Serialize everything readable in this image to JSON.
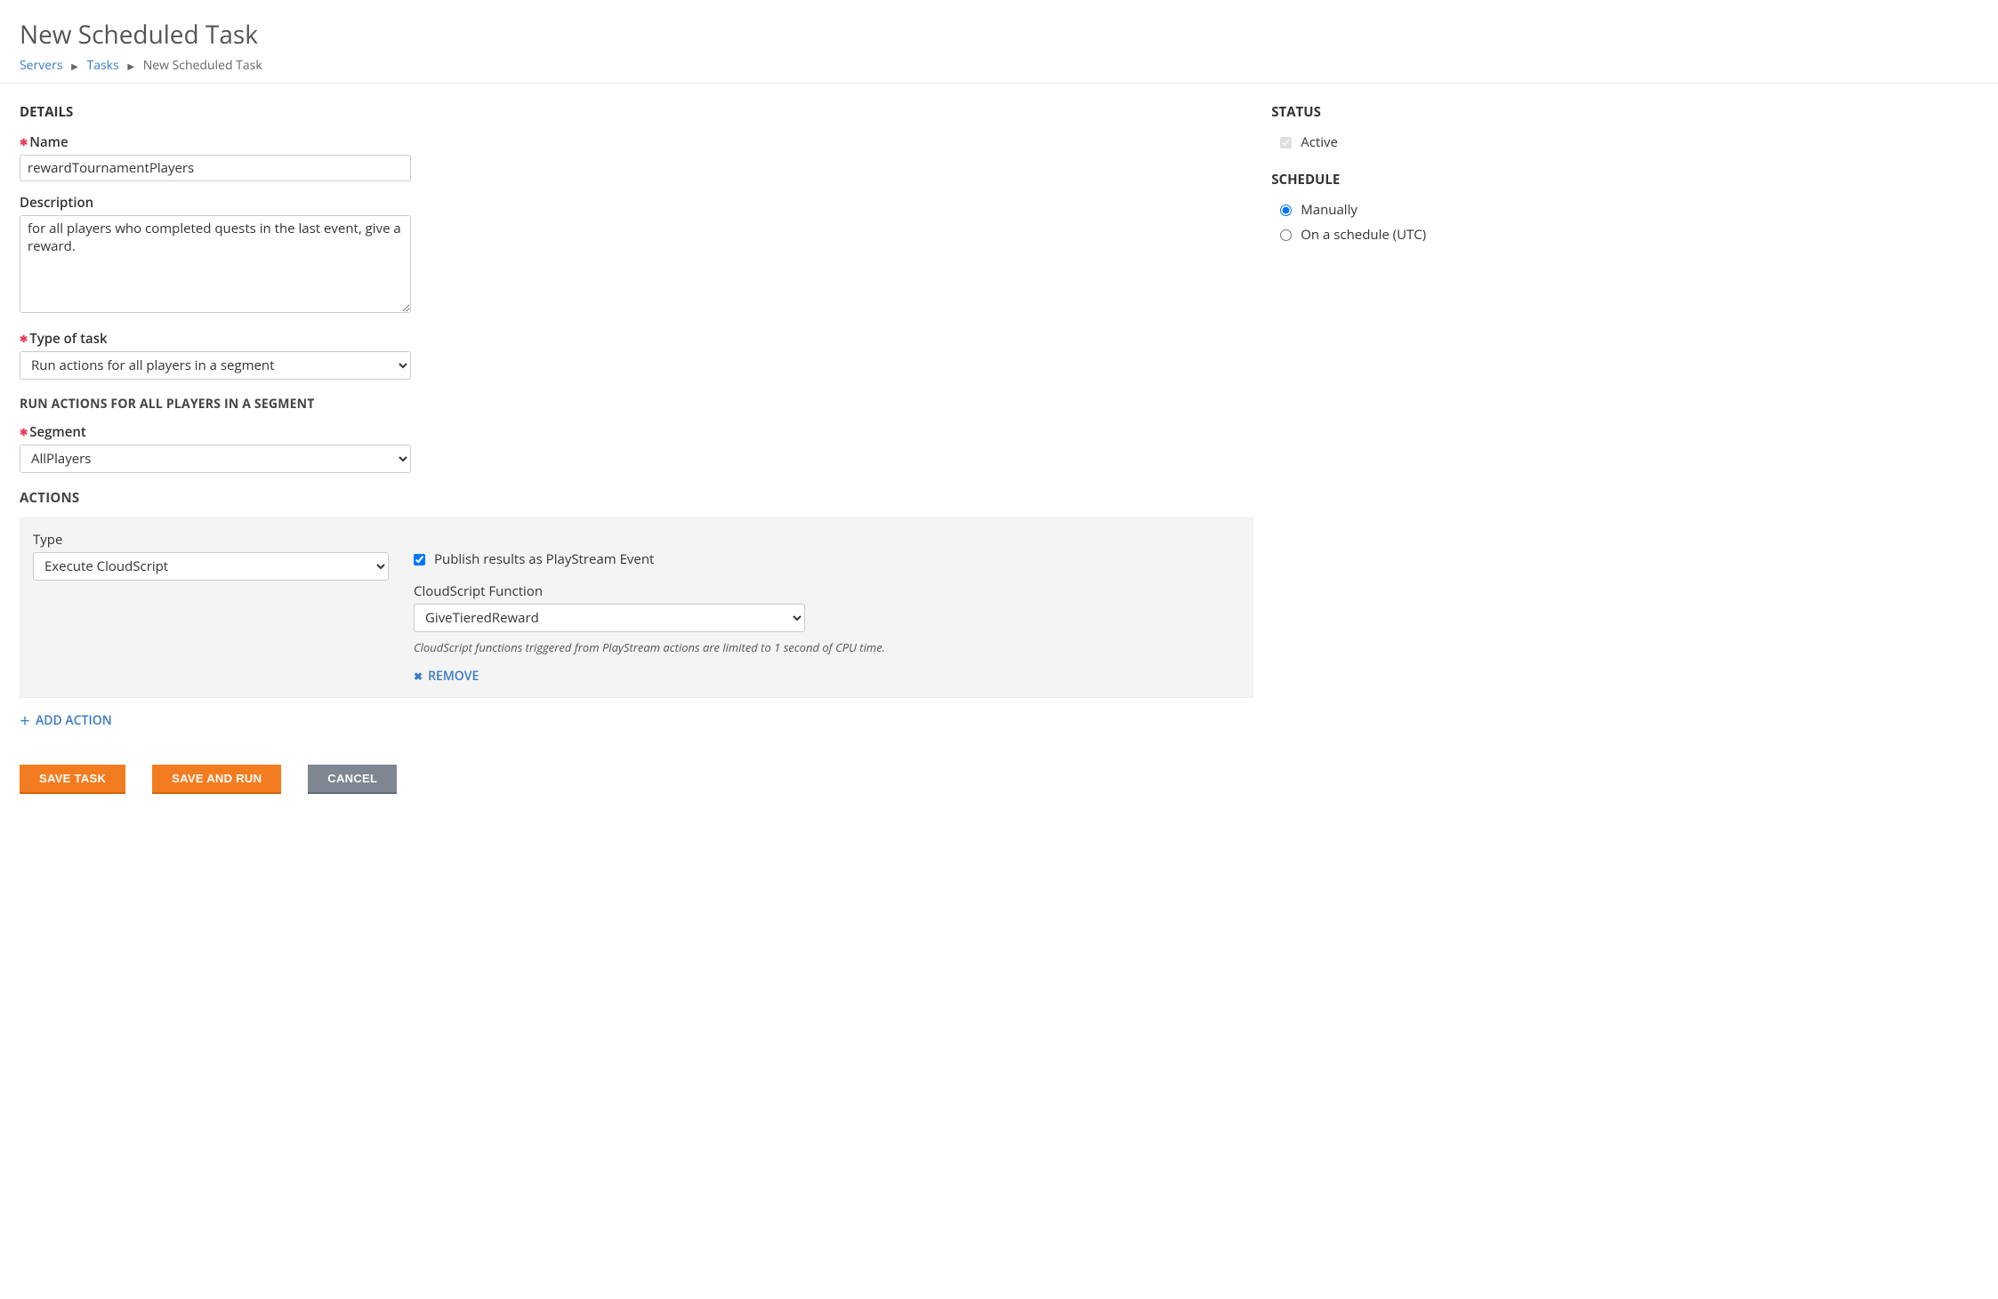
{
  "header": {
    "title": "New Scheduled Task",
    "breadcrumb": {
      "servers": "Servers",
      "tasks": "Tasks",
      "current": "New Scheduled Task"
    }
  },
  "details": {
    "title": "DETAILS",
    "name_label": "Name",
    "name_value": "rewardTournamentPlayers",
    "description_label": "Description",
    "description_value": "for all players who completed quests in the last event, give a reward.",
    "type_label": "Type of task",
    "type_value": "Run actions for all players in a segment"
  },
  "segment_section": {
    "title": "RUN ACTIONS FOR ALL PLAYERS IN A SEGMENT",
    "segment_label": "Segment",
    "segment_value": "AllPlayers"
  },
  "actions": {
    "title": "ACTIONS",
    "type_label": "Type",
    "type_value": "Execute CloudScript",
    "publish_label": "Publish results as PlayStream Event",
    "function_label": "CloudScript Function",
    "function_value": "GiveTieredReward",
    "helper": "CloudScript functions triggered from PlayStream actions are limited to 1 second of CPU time.",
    "remove_label": "REMOVE",
    "add_label": "ADD ACTION"
  },
  "buttons": {
    "save": "SAVE TASK",
    "save_run": "SAVE AND RUN",
    "cancel": "CANCEL"
  },
  "status": {
    "title": "STATUS",
    "active_label": "Active"
  },
  "schedule": {
    "title": "SCHEDULE",
    "manually": "Manually",
    "on_schedule": "On a schedule (UTC)"
  }
}
